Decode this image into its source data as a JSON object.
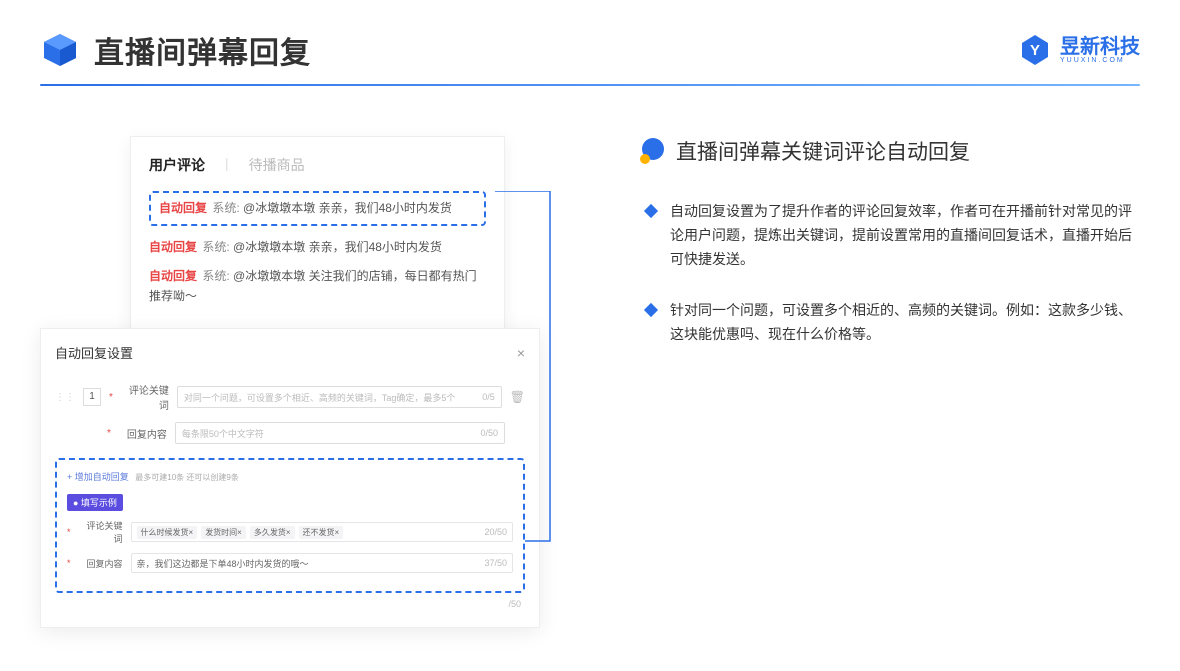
{
  "header": {
    "title": "直播间弹幕回复",
    "brand": "昱新科技",
    "brand_sub": "YUUXIN.COM"
  },
  "comments": {
    "tab_active": "用户评论",
    "tab_second": "待播商品",
    "row_highlight": {
      "badge": "自动回复",
      "sys": "系统:",
      "text": "@冰墩墩本墩 亲亲，我们48小时内发货"
    },
    "row2": {
      "badge": "自动回复",
      "sys": "系统:",
      "text": "@冰墩墩本墩 亲亲，我们48小时内发货"
    },
    "row3": {
      "badge": "自动回复",
      "sys": "系统:",
      "text": "@冰墩墩本墩 关注我们的店铺，每日都有热门推荐呦～"
    }
  },
  "settings": {
    "title": "自动回复设置",
    "num": "1",
    "keyword_label": "评论关键词",
    "keyword_ph": "对同一个问题，可设置多个相近、高频的关键词，Tag确定，最多5个",
    "keyword_count": "0/5",
    "content_label": "回复内容",
    "content_ph": "每条限50个中文字符",
    "content_count": "0/50",
    "add_line": "+ 增加自动回复",
    "add_tip": "最多可建10条 还可以创建9条",
    "ex_badge": "● 填写示例",
    "ex_kw_label": "评论关键词",
    "ex_tags": [
      "什么时候发货×",
      "发货时间×",
      "多久发货×",
      "还不发货×"
    ],
    "ex_kw_count": "20/50",
    "ex_ct_label": "回复内容",
    "ex_ct_text": "亲，我们这边都是下单48小时内发货的哦～",
    "ex_ct_count": "37/50",
    "outer_count": "/50"
  },
  "right": {
    "title": "直播间弹幕关键词评论自动回复",
    "b1": "自动回复设置为了提升作者的评论回复效率，作者可在开播前针对常见的评论用户问题，提炼出关键词，提前设置常用的直播间回复话术，直播开始后可快捷发送。",
    "b2": "针对同一个问题，可设置多个相近的、高频的关键词。例如：这款多少钱、这块能优惠吗、现在什么价格等。"
  }
}
